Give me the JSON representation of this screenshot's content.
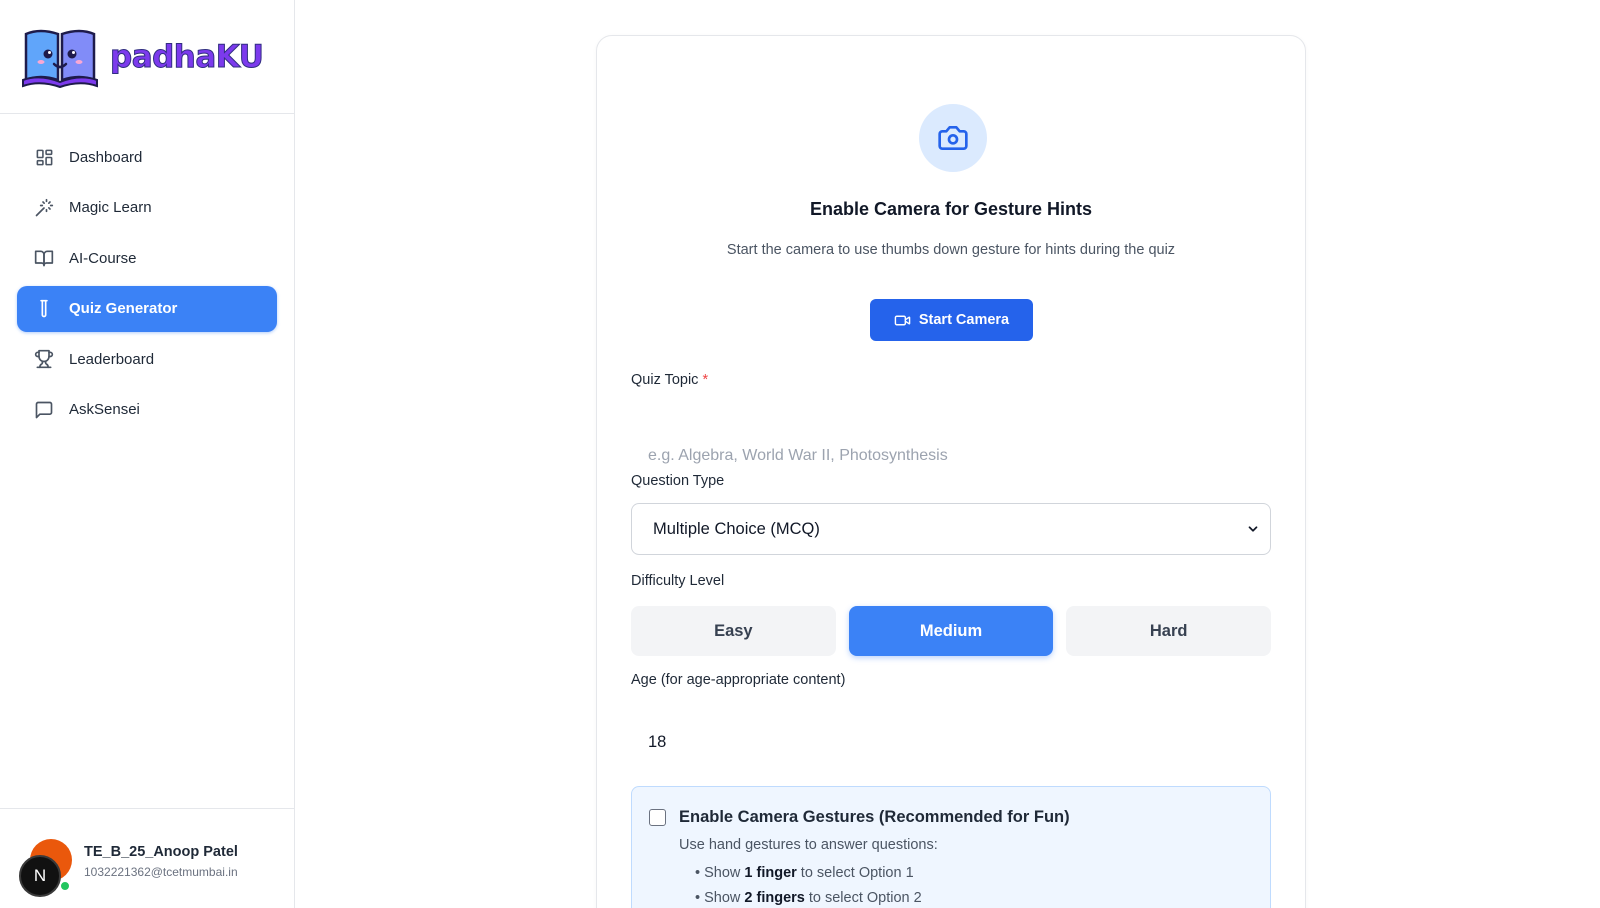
{
  "brand": {
    "name": "padhaKU"
  },
  "sidebar": {
    "items": [
      {
        "label": "Dashboard",
        "icon": "dashboard-grid-icon"
      },
      {
        "label": "Magic Learn",
        "icon": "magic-wand-icon"
      },
      {
        "label": "AI-Course",
        "icon": "open-book-icon"
      },
      {
        "label": "Quiz Generator",
        "icon": "test-tube-icon",
        "active": true
      },
      {
        "label": "Leaderboard",
        "icon": "trophy-icon"
      },
      {
        "label": "AskSensei",
        "icon": "chat-bubble-icon"
      }
    ]
  },
  "user": {
    "initial": "N",
    "name": "TE_B_25_Anoop Patel",
    "email": "1032221362@tcetmumbai.in",
    "status": "online"
  },
  "camera": {
    "title": "Enable Camera for Gesture Hints",
    "subtitle": "Start the camera to use thumbs down gesture for hints during the quiz",
    "button_label": "Start Camera"
  },
  "form": {
    "topic": {
      "label": "Quiz Topic",
      "required_mark": "*",
      "placeholder": "e.g. Algebra, World War II, Photosynthesis",
      "value": ""
    },
    "question_type": {
      "label": "Question Type",
      "selected": "Multiple Choice (MCQ)"
    },
    "difficulty": {
      "label": "Difficulty Level",
      "options": [
        "Easy",
        "Medium",
        "Hard"
      ],
      "selected": "Medium"
    },
    "age": {
      "label": "Age (for age-appropriate content)",
      "value": "18"
    }
  },
  "gestures": {
    "checked": false,
    "title": "Enable Camera Gestures (Recommended for Fun)",
    "subtitle": "Use hand gestures to answer questions:",
    "items": [
      {
        "prefix": "• Show ",
        "bold": "1 finger",
        "suffix": " to select Option 1"
      },
      {
        "prefix": "• Show ",
        "bold": "2 fingers",
        "suffix": " to select Option 2"
      }
    ]
  },
  "colors": {
    "accent": "#3b82f6",
    "accent_dark": "#2563eb",
    "online": "#22c55e",
    "required": "#ef4444"
  }
}
